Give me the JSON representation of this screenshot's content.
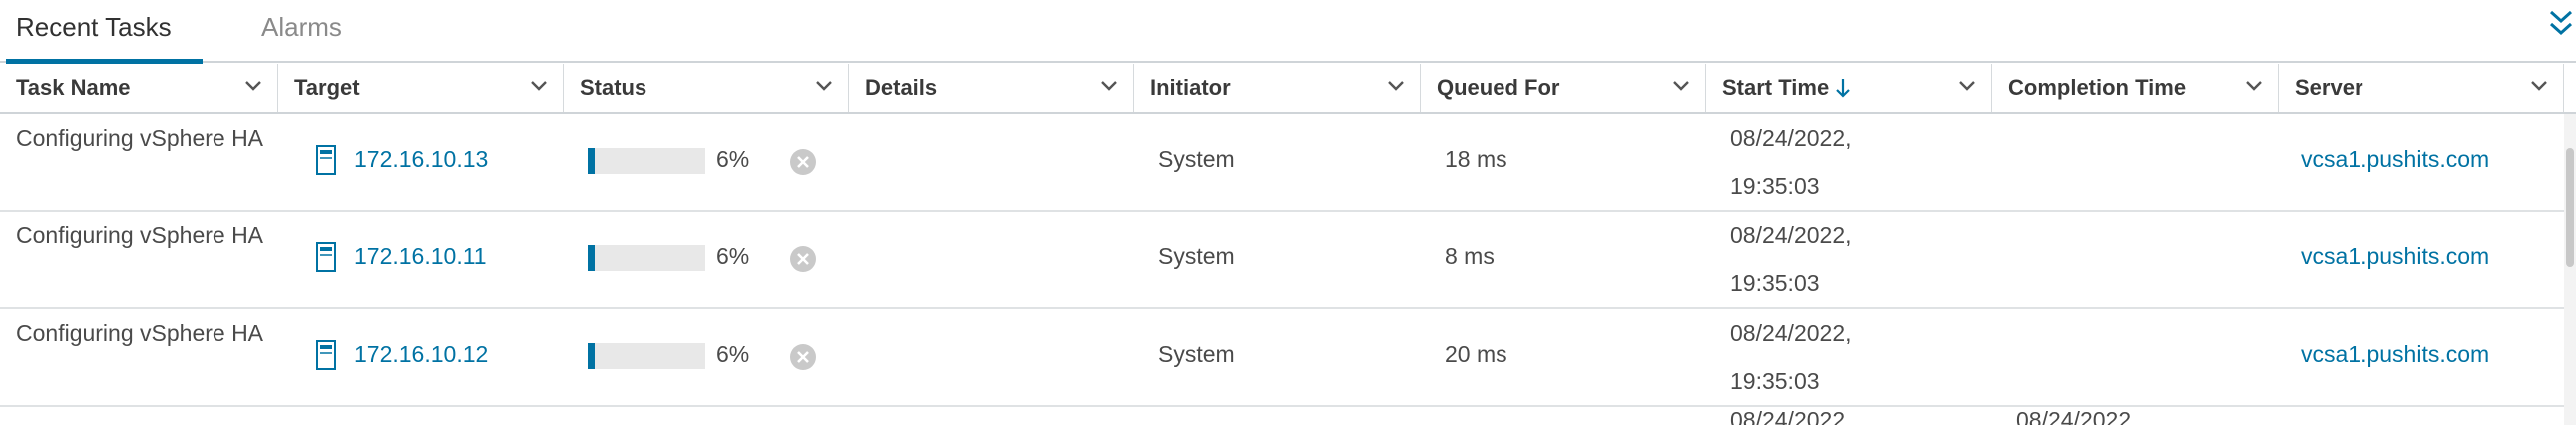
{
  "tabs": [
    {
      "label": "Recent Tasks",
      "active": true
    },
    {
      "label": "Alarms",
      "active": false
    }
  ],
  "columns": [
    {
      "label": "Task Name"
    },
    {
      "label": "Target"
    },
    {
      "label": "Status"
    },
    {
      "label": "Details"
    },
    {
      "label": "Initiator"
    },
    {
      "label": "Queued For"
    },
    {
      "label": "Start Time",
      "sorted": "descending"
    },
    {
      "label": "Completion Time"
    },
    {
      "label": "Server"
    }
  ],
  "rows": [
    {
      "task_name": "Configuring vSphere HA",
      "target": "172.16.10.13",
      "progress_percent": 6,
      "status_text": "6%",
      "details": "",
      "initiator": "System",
      "queued_for": "18 ms",
      "start_time": "08/24/2022, 19:35:03",
      "completion_time": "",
      "server": "vcsa1.pushits.com"
    },
    {
      "task_name": "Configuring vSphere HA",
      "target": "172.16.10.11",
      "progress_percent": 6,
      "status_text": "6%",
      "details": "",
      "initiator": "System",
      "queued_for": "8 ms",
      "start_time": "08/24/2022, 19:35:03",
      "completion_time": "",
      "server": "vcsa1.pushits.com"
    },
    {
      "task_name": "Configuring vSphere HA",
      "target": "172.16.10.12",
      "progress_percent": 6,
      "status_text": "6%",
      "details": "",
      "initiator": "System",
      "queued_for": "20 ms",
      "start_time": "08/24/2022, 19:35:03",
      "completion_time": "",
      "server": "vcsa1.pushits.com"
    }
  ],
  "partial_row": {
    "start_time": "08/24/2022",
    "completion_time": "08/24/2022"
  },
  "colors": {
    "accent": "#0072a3",
    "progress_track": "#e8e8e8",
    "divider": "#cfd4d8"
  },
  "icons": {
    "collapse": "double-chevron-down-icon",
    "column_menu": "chevron-down-icon",
    "sort": "arrow-down-icon",
    "host": "host-server-icon",
    "cancel": "cancel-circle-icon"
  }
}
